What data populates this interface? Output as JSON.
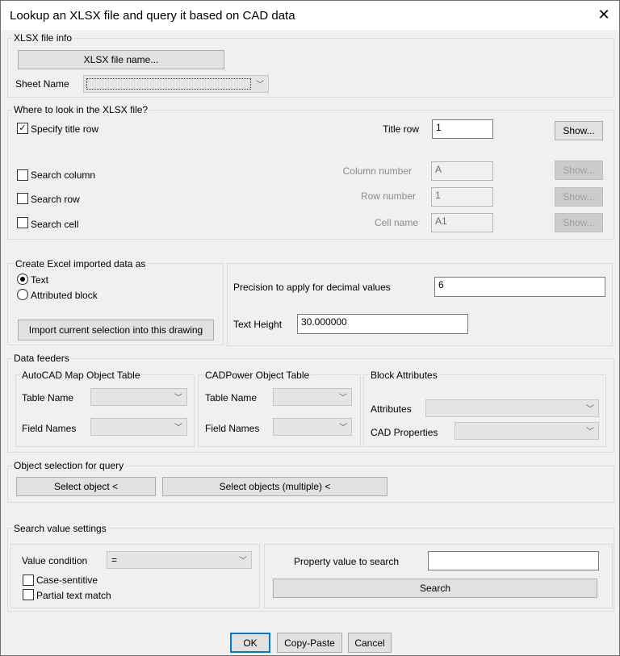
{
  "window": {
    "title": "Lookup an XLSX file and query it based on CAD data",
    "close_icon": "close-icon"
  },
  "file_info": {
    "legend": "XLSX file info",
    "file_button": "XLSX file name...",
    "sheet_label": "Sheet Name",
    "sheet_value": ""
  },
  "where": {
    "legend": "Where to look in the XLSX file?",
    "title_row": {
      "label": "Specify title row",
      "checked": true,
      "field_label": "Title row",
      "value": "1",
      "show": "Show..."
    },
    "search_column": {
      "label": "Search column",
      "checked": false,
      "field_label": "Column number",
      "value": "A",
      "show": "Show..."
    },
    "search_row": {
      "label": "Search row",
      "checked": false,
      "field_label": "Row number",
      "value": "1",
      "show": "Show..."
    },
    "search_cell": {
      "label": "Search cell",
      "checked": false,
      "field_label": "Cell name",
      "value": "A1",
      "show": "Show..."
    }
  },
  "create": {
    "legend": "Create Excel imported data as",
    "option_text": "Text",
    "option_block": "Attributed block",
    "selected": "Text",
    "import_button": "Import current selection into this drawing"
  },
  "precision": {
    "label": "Precision to apply for decimal values",
    "value": "6",
    "text_height_label": "Text Height",
    "text_height_value": "30.000000"
  },
  "feeders": {
    "legend": "Data feeders",
    "map": {
      "legend": "AutoCAD Map Object Table",
      "table_label": "Table Name",
      "field_label": "Field Names"
    },
    "cadpower": {
      "legend": "CADPower Object Table",
      "table_label": "Table Name",
      "field_label": "Field Names"
    },
    "block": {
      "legend": "Block Attributes",
      "attributes_label": "Attributes",
      "cad_props_label": "CAD Properties"
    }
  },
  "selection": {
    "legend": "Object selection for query",
    "select_one": "Select object <",
    "select_multi": "Select objects (multiple) <"
  },
  "search": {
    "legend": "Search value settings",
    "condition_label": "Value condition",
    "condition_value": "=",
    "case_label": "Case-sentitive",
    "partial_label": "Partial text match",
    "property_label": "Property value to search",
    "property_value": "",
    "search_button": "Search"
  },
  "footer": {
    "ok": "OK",
    "copy_paste": "Copy-Paste",
    "cancel": "Cancel"
  }
}
